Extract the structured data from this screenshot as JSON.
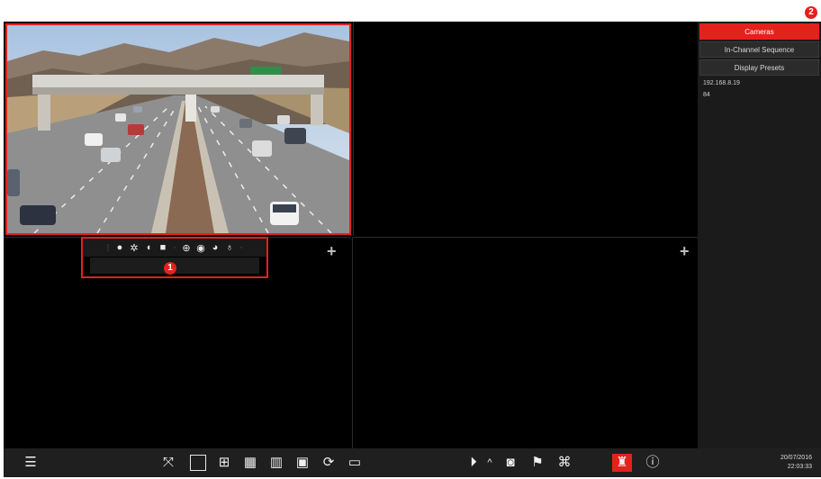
{
  "callouts": {
    "one": "1",
    "two": "2"
  },
  "sidebar": {
    "buttons": [
      {
        "label": "Cameras",
        "active": true
      },
      {
        "label": "In-Channel Sequence",
        "active": false
      },
      {
        "label": "Display Presets",
        "active": false
      }
    ],
    "items": [
      "192.168.8.19",
      "84"
    ]
  },
  "cells": {
    "add_symbol": "+"
  },
  "taskbar": {
    "date": "20/07/2016",
    "time": "22:03:33"
  },
  "icons": [
    "menu-icon",
    "fullscreen-icon",
    "layout-1-icon",
    "layout-4-icon",
    "layout-9-icon",
    "layout-16-icon",
    "layout-custom-icon",
    "sequence-icon",
    "preview-mode-icon",
    "playback-icon",
    "chevron-up-icon",
    "record-icon",
    "manual-alarm-icon",
    "ptz-icon",
    "alarm-indicator-icon",
    "info-icon"
  ]
}
